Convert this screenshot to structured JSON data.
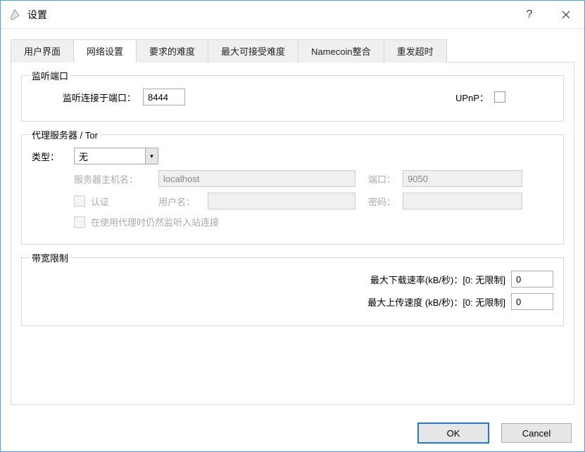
{
  "window": {
    "title": "设置"
  },
  "tabs": {
    "ui": "用户界面",
    "network": "网络设置",
    "difficulty": "要求的难度",
    "max_difficulty": "最大可接受难度",
    "namecoin": "Namecoin整合",
    "resend": "重发超时"
  },
  "listen": {
    "legend": "监听端口",
    "port_label": "监听连接于端口：",
    "port_value": "8444",
    "upnp_label": "UPnP："
  },
  "proxy": {
    "legend": "代理服务器 / Tor",
    "type_label": "类型：",
    "type_value": "无",
    "host_label": "服务器主机名：",
    "host_value": "localhost",
    "port_label": "端口：",
    "port_value": "9050",
    "auth_label": "认证",
    "user_label": "用户名：",
    "pass_label": "密码：",
    "incoming_label": "在使用代理时仍然监听入站连接"
  },
  "bandwidth": {
    "legend": "带宽限制",
    "download_label": "最大下载速率(kB/秒)：[0: 无限制]",
    "download_value": "0",
    "upload_label": "最大上传速度 (kB/秒)：[0: 无限制]",
    "upload_value": "0"
  },
  "buttons": {
    "ok": "OK",
    "cancel": "Cancel"
  }
}
